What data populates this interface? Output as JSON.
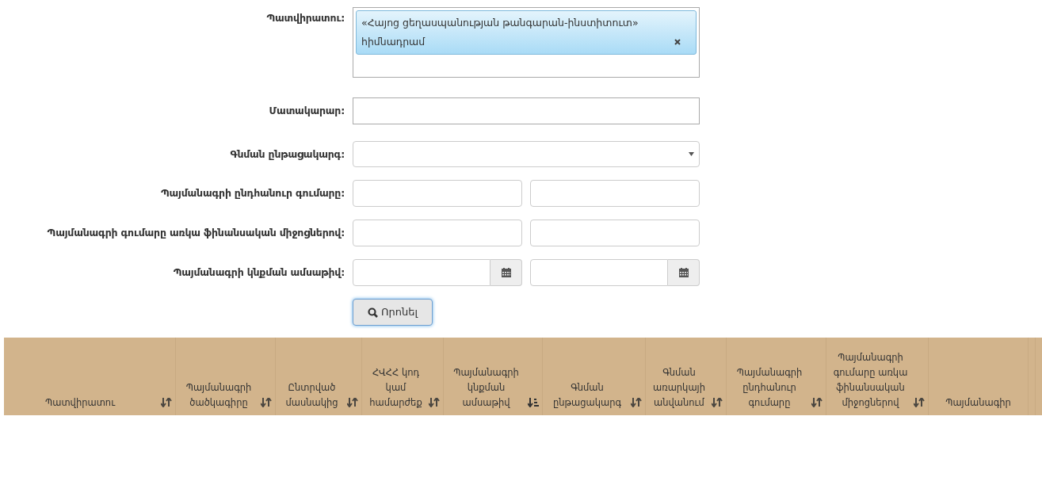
{
  "form": {
    "fields": [
      {
        "kind": "tags",
        "label": "Պատվիրատու:",
        "tags": [
          {
            "text": "«Հայոց ցեղասպանության թանգարան-ինստիտուտ» հիմնադրամ"
          }
        ]
      },
      {
        "kind": "text",
        "label": "Մատակարար:"
      },
      {
        "kind": "select",
        "label": "Գնման ընթացակարգ:"
      },
      {
        "kind": "range",
        "label": "Պայմանագրի ընդհանուր գումարը:"
      },
      {
        "kind": "range",
        "label": "Պայմանագրի գումարը առկա ֆինանսական միջոցներով:"
      },
      {
        "kind": "daterange",
        "label": "Պայմանագրի կնքման ամսաթիվ:"
      }
    ],
    "search_button": "Որոնել"
  },
  "table": {
    "columns": [
      {
        "label": "Պատվիրատու",
        "sortable": true,
        "sorted": false
      },
      {
        "label": "Պայմանագրի ծածկագիրը",
        "sortable": true,
        "sorted": false
      },
      {
        "label": "Ընտրված մասնակից",
        "sortable": true,
        "sorted": false
      },
      {
        "label": "ՀՎՀՀ կոդ կամ համարժեք",
        "sortable": true,
        "sorted": false
      },
      {
        "label": "Պայմանագրի կնքման ամսաթիվ",
        "sortable": true,
        "sorted": true
      },
      {
        "label": "Գնման ընթացակարգ",
        "sortable": true,
        "sorted": false
      },
      {
        "label": "Գնման առարկայի անվանում",
        "sortable": true,
        "sorted": false
      },
      {
        "label": "Պայմանագրի ընդհանուր գումարը",
        "sortable": true,
        "sorted": false
      },
      {
        "label": "Պայմանագրի գումարը առկա ֆինանսական միջոցներով",
        "sortable": true,
        "sorted": false
      },
      {
        "label": "Պայմանագիր",
        "sortable": false
      }
    ]
  }
}
